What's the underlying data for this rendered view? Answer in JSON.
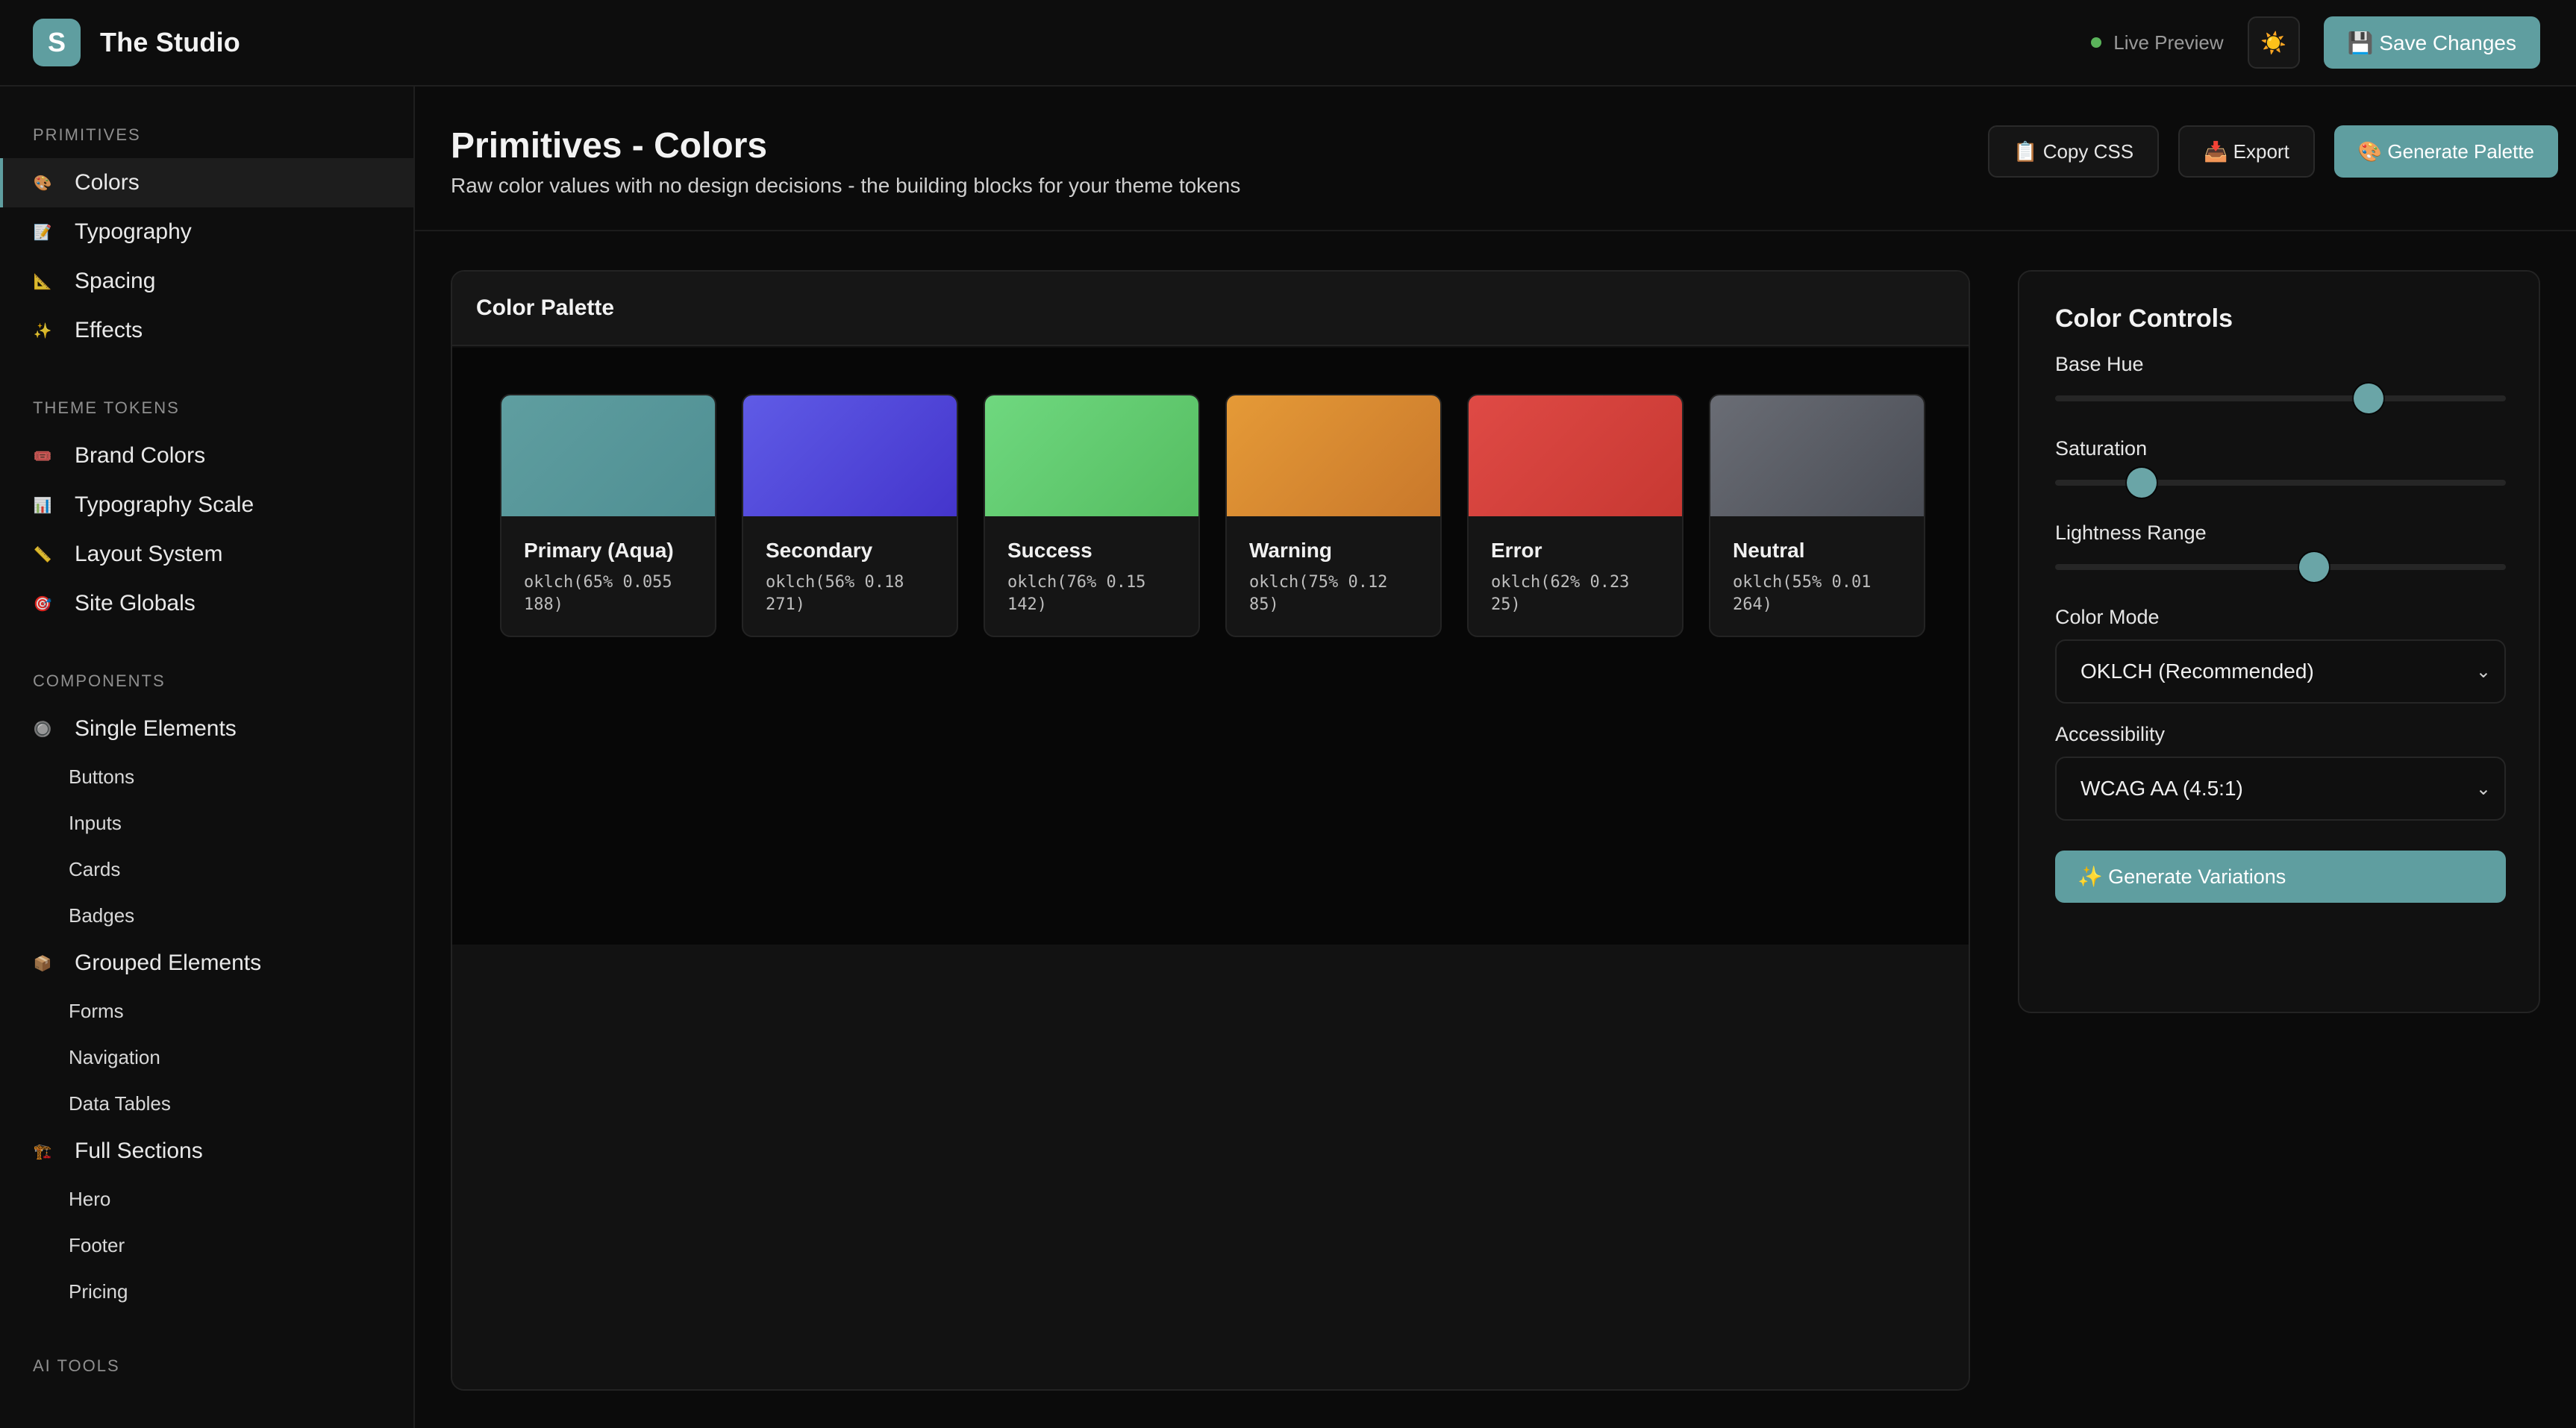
{
  "app": {
    "brand_letter": "S",
    "title": "The Studio"
  },
  "topbar": {
    "live_preview": "Live Preview",
    "theme_icon": "☀️",
    "save_label": "💾 Save Changes"
  },
  "sidebar": {
    "sections": [
      {
        "title": "PRIMITIVES",
        "items": [
          {
            "label": "Colors",
            "icon": "🎨"
          },
          {
            "label": "Typography",
            "icon": "📝"
          },
          {
            "label": "Spacing",
            "icon": "📐"
          },
          {
            "label": "Effects",
            "icon": "✨"
          }
        ]
      },
      {
        "title": "THEME TOKENS",
        "items": [
          {
            "label": "Brand Colors",
            "icon": "🎟️"
          },
          {
            "label": "Typography Scale",
            "icon": "📊"
          },
          {
            "label": "Layout System",
            "icon": "📏"
          },
          {
            "label": "Site Globals",
            "icon": "🎯"
          }
        ]
      },
      {
        "title": "COMPONENTS",
        "groups": [
          {
            "label": "Single Elements",
            "icon": "🔘",
            "children": [
              "Buttons",
              "Inputs",
              "Cards",
              "Badges"
            ]
          },
          {
            "label": "Grouped Elements",
            "icon": "📦",
            "children": [
              "Forms",
              "Navigation",
              "Data Tables"
            ]
          },
          {
            "label": "Full Sections",
            "icon": "🏗️",
            "children": [
              "Hero",
              "Footer",
              "Pricing"
            ]
          }
        ]
      },
      {
        "title": "AI TOOLS"
      }
    ]
  },
  "page": {
    "title": "Primitives - Colors",
    "subtitle": "Raw color values with no design decisions - the building blocks for your theme tokens",
    "actions": {
      "copy_css": "📋 Copy CSS",
      "export": "📥 Export",
      "generate": "🎨 Generate Palette"
    }
  },
  "palette": {
    "header": "Color Palette",
    "swatches": [
      {
        "name": "Primary (Aqua)",
        "code": "oklch(65% 0.055 188)",
        "color_top": "#5f9ea0",
        "color_bottom": "#4f8f93"
      },
      {
        "name": "Secondary",
        "code": "oklch(56% 0.18 271)",
        "color_top": "#5f5be6",
        "color_bottom": "#4435cc"
      },
      {
        "name": "Success",
        "code": "oklch(76% 0.15 142)",
        "color_top": "#6fd87f",
        "color_bottom": "#55bd61"
      },
      {
        "name": "Warning",
        "code": "oklch(75% 0.12 85)",
        "color_top": "#e59a37",
        "color_bottom": "#c9782b"
      },
      {
        "name": "Error",
        "code": "oklch(62% 0.23 25)",
        "color_top": "#df4a45",
        "color_bottom": "#c73832"
      },
      {
        "name": "Neutral",
        "code": "oklch(55% 0.01 264)",
        "color_top": "#6a6d75",
        "color_bottom": "#4a4d55"
      }
    ]
  },
  "controls": {
    "title": "Color Controls",
    "base_hue_label": "Base Hue",
    "base_hue_value": 0.71,
    "saturation_label": "Saturation",
    "saturation_value": 0.17,
    "lightness_label": "Lightness Range",
    "lightness_value": 0.58,
    "mode_label": "Color Mode",
    "mode_value": "OKLCH (Recommended)",
    "accessibility_label": "Accessibility",
    "accessibility_value": "WCAG AA (4.5:1)",
    "generate_variations": "✨ Generate Variations"
  },
  "colors": {
    "accent": "#5f9ea0",
    "live_dot": "#5ab35a"
  }
}
